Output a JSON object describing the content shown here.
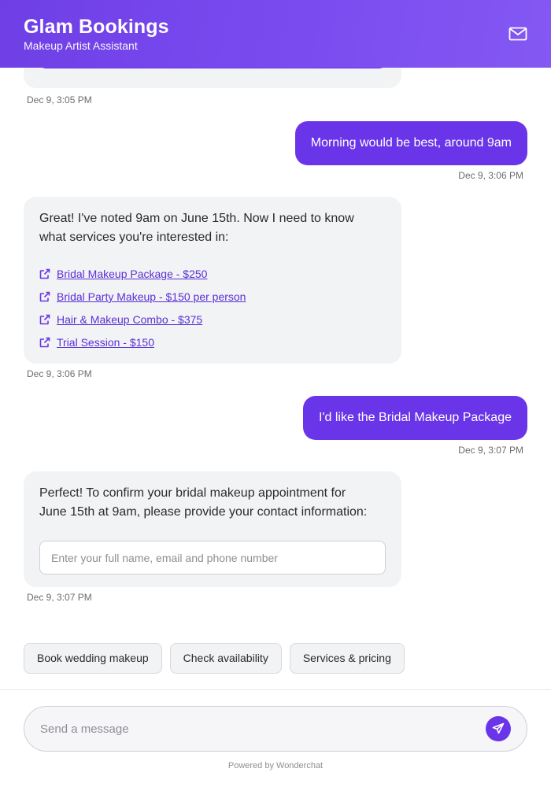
{
  "header": {
    "title": "Glam Bookings",
    "subtitle": "Makeup Artist Assistant",
    "mail_icon": "mail-icon"
  },
  "colors": {
    "accent": "#6a35e8",
    "bot_bubble": "#f2f3f5",
    "link": "#5b2fd6"
  },
  "messages": [
    {
      "role": "bot",
      "timestamp": "Dec 9, 3:05 PM"
    },
    {
      "role": "user",
      "text": "Morning would be best, around 9am",
      "timestamp": "Dec 9, 3:06 PM"
    },
    {
      "role": "bot",
      "text_line1": "Great! I've noted 9am on June 15th. Now I need to know",
      "text_line2": "what services you're interested in:",
      "links": [
        "Bridal Makeup Package - $250",
        "Bridal Party Makeup - $150 per person",
        "Hair & Makeup Combo - $375",
        "Trial Session - $150"
      ],
      "link_icon": "external-link-icon",
      "timestamp": "Dec 9, 3:06 PM"
    },
    {
      "role": "user",
      "text": "I'd like the Bridal Makeup Package",
      "timestamp": "Dec 9, 3:07 PM"
    },
    {
      "role": "bot",
      "text_line1": "Perfect! To confirm your bridal makeup appointment for",
      "text_line2": "June 15th at 9am, please provide your contact information:",
      "input_placeholder": "Enter your full name, email and phone number",
      "timestamp": "Dec 9, 3:07 PM"
    }
  ],
  "quick_replies": [
    "Book wedding makeup",
    "Check availability",
    "Services & pricing"
  ],
  "composer": {
    "placeholder": "Send a message",
    "send_icon": "send-icon"
  },
  "footer": {
    "powered_by": "Powered by Wonderchat"
  }
}
